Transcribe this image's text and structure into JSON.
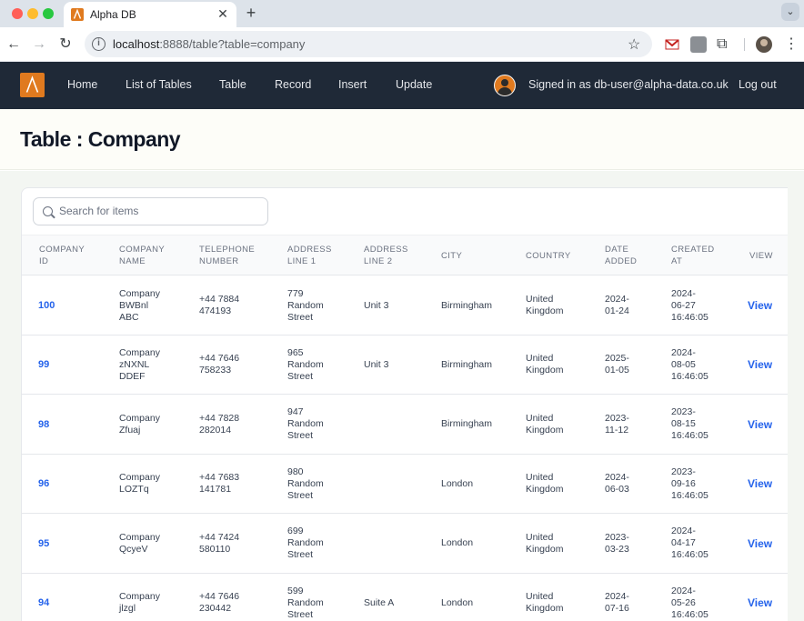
{
  "browser": {
    "tab_title": "Alpha DB",
    "url_host": "localhost",
    "url_rest": ":8888/table?table=company"
  },
  "nav": {
    "items": [
      "Home",
      "List of Tables",
      "Table",
      "Record",
      "Insert",
      "Update"
    ],
    "signed_in": "Signed in as db-user@alpha-data.co.uk",
    "logout": "Log out"
  },
  "page": {
    "title": "Table : Company"
  },
  "search": {
    "placeholder": "Search for items"
  },
  "table": {
    "headers": [
      [
        "COMPANY",
        "ID"
      ],
      [
        "COMPANY",
        "NAME"
      ],
      [
        "TELEPHONE",
        "NUMBER"
      ],
      [
        "ADDRESS",
        "LINE 1"
      ],
      [
        "ADDRESS",
        "LINE 2"
      ],
      [
        "CITY"
      ],
      [
        "COUNTRY"
      ],
      [
        "DATE",
        "ADDED"
      ],
      [
        "CREATED",
        "AT"
      ],
      [
        "VIEW"
      ]
    ],
    "view_label": "View",
    "rows": [
      {
        "id": "100",
        "name": [
          "Company",
          "BWBnl",
          "ABC"
        ],
        "phone": [
          "+44 7884",
          "474193"
        ],
        "addr1": [
          "779",
          "Random",
          "Street"
        ],
        "addr2": "Unit 3",
        "city": "Birmingham",
        "country": [
          "United",
          "Kingdom"
        ],
        "date_added": [
          "2024-",
          "01-24"
        ],
        "created": [
          "2024-",
          "06-27",
          "16:46:05"
        ]
      },
      {
        "id": "99",
        "name": [
          "Company",
          "zNXNL",
          "DDEF"
        ],
        "phone": [
          "+44 7646",
          "758233"
        ],
        "addr1": [
          "965",
          "Random",
          "Street"
        ],
        "addr2": "Unit 3",
        "city": "Birmingham",
        "country": [
          "United",
          "Kingdom"
        ],
        "date_added": [
          "2025-",
          "01-05"
        ],
        "created": [
          "2024-",
          "08-05",
          "16:46:05"
        ]
      },
      {
        "id": "98",
        "name": [
          "Company",
          "Zfuaj"
        ],
        "phone": [
          "+44 7828",
          "282014"
        ],
        "addr1": [
          "947",
          "Random",
          "Street"
        ],
        "addr2": "",
        "city": "Birmingham",
        "country": [
          "United",
          "Kingdom"
        ],
        "date_added": [
          "2023-",
          "11-12"
        ],
        "created": [
          "2023-",
          "08-15",
          "16:46:05"
        ]
      },
      {
        "id": "96",
        "name": [
          "Company",
          "LOZTq"
        ],
        "phone": [
          "+44 7683",
          "141781"
        ],
        "addr1": [
          "980",
          "Random",
          "Street"
        ],
        "addr2": "",
        "city": "London",
        "country": [
          "United",
          "Kingdom"
        ],
        "date_added": [
          "2024-",
          "06-03"
        ],
        "created": [
          "2023-",
          "09-16",
          "16:46:05"
        ]
      },
      {
        "id": "95",
        "name": [
          "Company",
          "QcyeV"
        ],
        "phone": [
          "+44 7424",
          "580110"
        ],
        "addr1": [
          "699",
          "Random",
          "Street"
        ],
        "addr2": "",
        "city": "London",
        "country": [
          "United",
          "Kingdom"
        ],
        "date_added": [
          "2023-",
          "03-23"
        ],
        "created": [
          "2024-",
          "04-17",
          "16:46:05"
        ]
      },
      {
        "id": "94",
        "name": [
          "Company",
          "jlzgl"
        ],
        "phone": [
          "+44 7646",
          "230442"
        ],
        "addr1": [
          "599",
          "Random",
          "Street"
        ],
        "addr2": "Suite A",
        "city": "London",
        "country": [
          "United",
          "Kingdom"
        ],
        "date_added": [
          "2024-",
          "07-16"
        ],
        "created": [
          "2024-",
          "05-26",
          "16:46:05"
        ]
      }
    ]
  }
}
